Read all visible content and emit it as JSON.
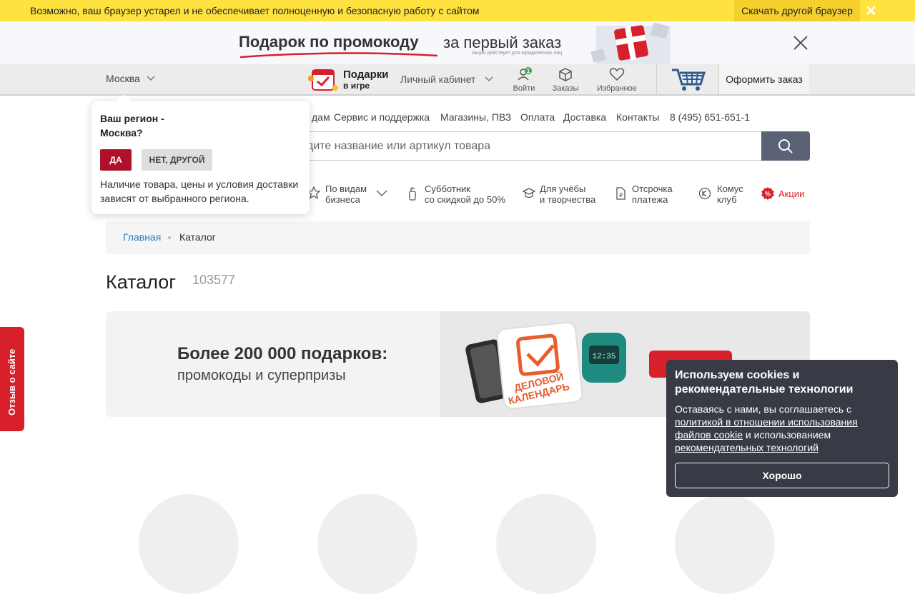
{
  "old_browser": {
    "message": "Возможно, ваш браузер устарел и не обеспечивает полноценную и безопасную работу с сайтом",
    "download_label": "Скачать другой браузер",
    "close_label": "✕"
  },
  "promo": {
    "headline": "Подарок по промокоду",
    "sub": "за первый заказ",
    "note": "Акция действует для юридических лиц"
  },
  "header": {
    "city": "Москва",
    "gifts_title": "Подарки",
    "gifts_sub": "в игре",
    "cabinet": "Личный кабинет",
    "login": "Войти",
    "orders": "Заказы",
    "favorites": "Избранное",
    "login_badge": "1",
    "checkout": "Оформить заказ"
  },
  "nav": {
    "items": [
      "дам",
      "Сервис и поддержка",
      "Магазины, ПВЗ",
      "Оплата",
      "Доставка",
      "Контакты",
      "8 (495) 651-651-1"
    ]
  },
  "search": {
    "placeholder": "дите название или артикул товара"
  },
  "categories": {
    "business_1": "По видам",
    "business_2": "бизнеса",
    "subbotnik_1": "Субботник",
    "subbotnik_2": "со скидкой до 50%",
    "study_1": "Для учёбы",
    "study_2": "и творчества",
    "deferral_1": "Отсрочка",
    "deferral_2": "платежа",
    "club_1": "Комус",
    "club_2": "клуб",
    "promo": "Акции"
  },
  "region_popup": {
    "question_1": "Ваш регион -",
    "question_2": "Москва?",
    "yes": "ДА",
    "no": "НЕТ, ДРУГОЙ",
    "note": "Наличие товара, цены и условия доставки зависят от выбранного региона."
  },
  "breadcrumb": {
    "home": "Главная",
    "current": "Каталог"
  },
  "page": {
    "title": "Каталог",
    "count": "103577"
  },
  "banner": {
    "line1": "Более 200 000 подарков:",
    "line2": "промокоды и суперпризы",
    "calendar_1": "ДЕЛОВОЙ",
    "calendar_2": "КАЛЕНДАРЬ"
  },
  "feedback": {
    "label": "Отзыв о сайте"
  },
  "cookies": {
    "title": "Используем cookies и рекомендательные технологии",
    "text_1": "Оставаясь с нами, вы соглашаетесь с ",
    "link_1": "политикой в отношении использования файлов cookie",
    "text_2": " и использованием ",
    "link_2": "рекомендательных технологий",
    "ok": "Хорошо"
  },
  "colors": {
    "accent_red": "#d81f2c",
    "yellow_bar": "#ffe23f",
    "search_button": "#5b6276",
    "cookies_bg": "#383b45"
  }
}
